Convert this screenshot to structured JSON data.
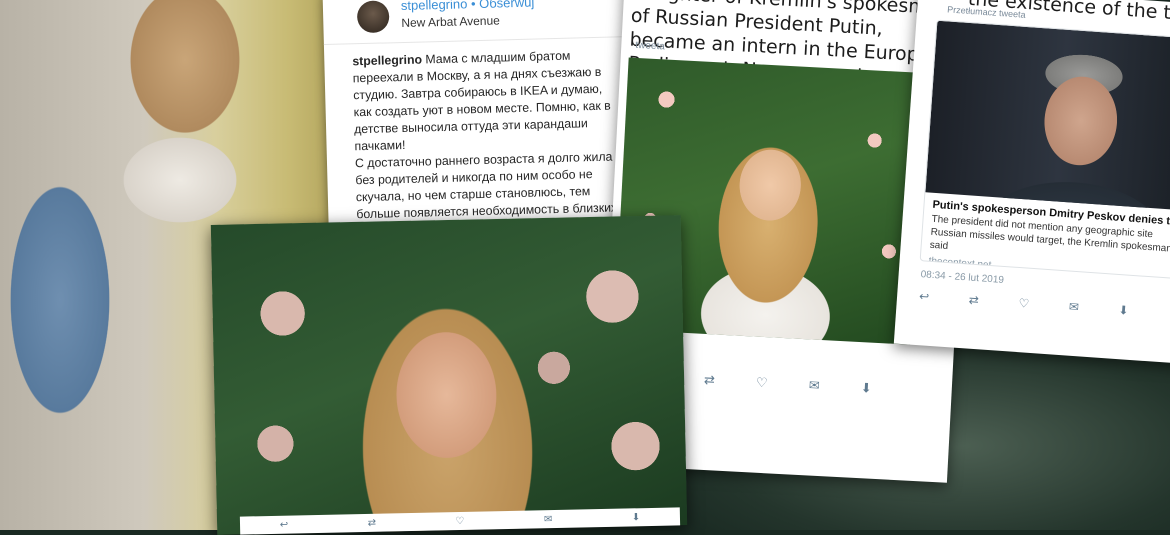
{
  "insta": {
    "handle": "stpellegrino • Обserwuj",
    "location": "New Arbat Avenue",
    "username": "stpellegrino",
    "caption": "Мама с младшим братом переехали в Москву, а я на днях съезжаю в студию. Завтра собираюсь в IKEA и думаю, как создать уют в новом месте. Помню, как в детстве выносила оттуда эти карандаши пачками!",
    "caption2": "С достаточно раннего возраста я долго жила без родителей и никогда по ним особо не скучала, но чем старше становлюсь, тем больше появляется необходимость в близких людях, особенно..."
  },
  "tweet_center": {
    "headline": "daughter of Kremlin's spokesman of Russian President Putin, became an intern in the European Parliament, No comment",
    "label": "tweeta",
    "actions": [
      "↩",
      "⇄",
      "♡",
      "✉",
      "⬇"
    ]
  },
  "tweet_right": {
    "headline": "the existence of the target list.",
    "label": "Przetłumacz tweeta",
    "link_title": "Putin's spokesperson Dmitry Peskov denies the existence of",
    "link_desc": "The president did not mention any geographic site Russian missiles would target, the Kremlin spokesman said",
    "link_url": "thecontext.net",
    "time": "08:34 - 26 lut 2019",
    "actions": [
      "↩",
      "⇄",
      "♡",
      "✉",
      "⬇"
    ]
  },
  "front_strip": [
    "↩",
    "⇄",
    "♡",
    "✉",
    "⬇"
  ]
}
